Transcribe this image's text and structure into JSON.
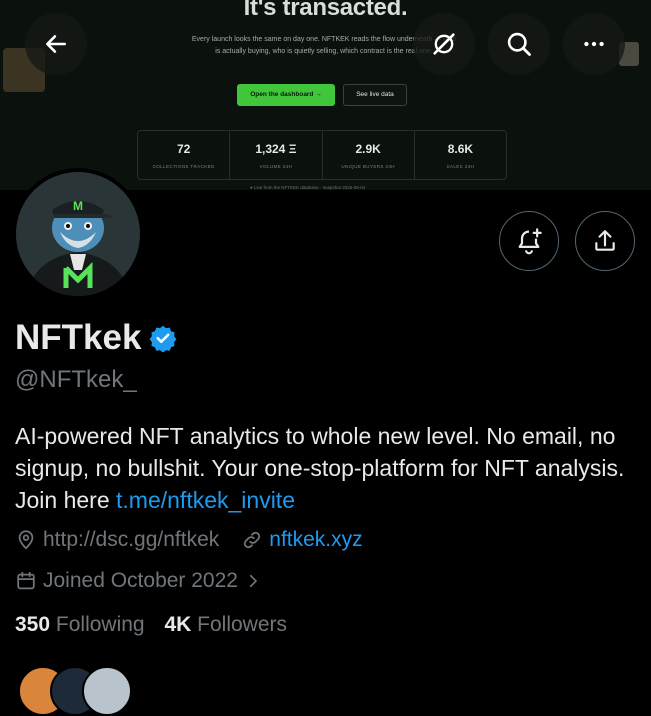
{
  "banner": {
    "headline": "It's transacted.",
    "description": "Every launch looks the same on day one. NFTKEK reads the flow underneath — who is actually buying, who is quietly selling, which contract is the real one.",
    "primary_button": "Open the dashboard →",
    "secondary_button": "See live data",
    "stats": [
      {
        "value": "72",
        "label": "COLLECTIONS TRACKED"
      },
      {
        "value": "1,324 Ξ",
        "label": "VOLUME 24H"
      },
      {
        "value": "2.9K",
        "label": "UNIQUE BUYERS 24H"
      },
      {
        "value": "8.6K",
        "label": "SALES 24H"
      }
    ],
    "footnote": "● Live from the NFTKEK database · snapshot 2026-08-04"
  },
  "top_bar": {
    "back_icon": "arrow-left-icon",
    "translate_icon": "satellite-off-icon",
    "search_icon": "search-icon",
    "more_icon": "more-horizontal-icon"
  },
  "profile": {
    "name": "NFTkek",
    "verified_color": "#1d9bf0",
    "handle": "@NFTkek_",
    "bio_text": "AI-powered NFT analytics to whole new level. No email, no signup, no bullshit. Your one-stop-platform for NFT analysis. Join here ",
    "bio_link": "t.me/nftkek_invite",
    "location": "http://dsc.gg/nftkek",
    "website": "nftkek.xyz",
    "joined": "Joined October 2022",
    "following_count": "350",
    "following_label": "Following",
    "followers_count": "4K",
    "followers_label": "Followers"
  },
  "colors": {
    "accent": "#1d9bf0",
    "muted": "#71767b",
    "banner_green": "#41c53a"
  }
}
